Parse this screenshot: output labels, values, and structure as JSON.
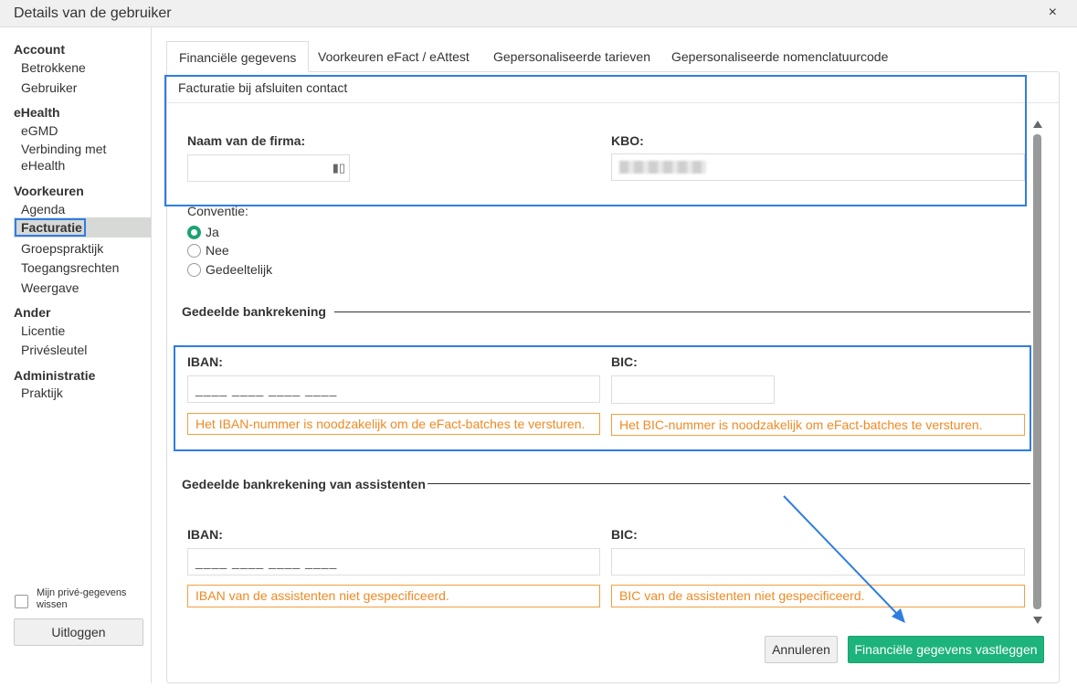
{
  "window": {
    "title": "Details van de gebruiker",
    "close_icon": "×"
  },
  "sidebar": {
    "groups": [
      {
        "heading": "Account",
        "items": [
          "Betrokkene",
          "Gebruiker"
        ]
      },
      {
        "heading": "eHealth",
        "items": [
          "eGMD",
          "Verbinding met",
          "eHealth"
        ]
      },
      {
        "heading": "Voorkeuren",
        "items": [
          "Agenda",
          "Facturatie",
          "Groepspraktijk",
          "Toegangsrechten",
          "Weergave"
        ]
      },
      {
        "heading": "Ander",
        "items": [
          "Licentie",
          "Privésleutel"
        ]
      },
      {
        "heading": "Administratie",
        "items": [
          "Praktijk"
        ]
      }
    ],
    "active_item": "Facturatie",
    "private_data_label": "Mijn privé-gegevens wissen",
    "logout_label": "Uitloggen"
  },
  "tabs": [
    {
      "label": "Financiële gegevens",
      "active": true
    },
    {
      "label": "Voorkeuren eFact / eAttest",
      "active": false
    },
    {
      "label": "Gepersonaliseerde tarieven",
      "active": false
    },
    {
      "label": "Gepersonaliseerde nomenclatuurcode",
      "active": false
    }
  ],
  "form": {
    "section_title": "Facturatie bij afsluiten contact",
    "company_name_label": "Naam van de firma:",
    "company_name_value": "",
    "kbo_label": "KBO:",
    "convention_label": "Conventie:",
    "convention_options": [
      {
        "label": "Ja",
        "selected": true
      },
      {
        "label": "Nee",
        "selected": false
      },
      {
        "label": "Gedeeltelijk",
        "selected": false
      }
    ],
    "shared_account": {
      "title": "Gedeelde bankrekening",
      "iban_label": "IBAN:",
      "iban_mask": "____ ____ ____ ____",
      "bic_label": "BIC:",
      "bic_value": "",
      "iban_warning": "Het IBAN-nummer is noodzakelijk om de eFact-batches te versturen.",
      "bic_warning": "Het BIC-nummer is noodzakelijk om eFact-batches te versturen."
    },
    "assistants_account": {
      "title": "Gedeelde bankrekening van assistenten",
      "iban_label": "IBAN:",
      "iban_mask": "____ ____ ____ ____",
      "bic_label": "BIC:",
      "bic_value": "",
      "iban_warning": "IBAN van de assistenten niet gespecificeerd.",
      "bic_warning": "BIC van de assistenten niet gespecificeerd."
    }
  },
  "actions": {
    "cancel_label": "Annuleren",
    "save_label": "Financiële gegevens vastleggen"
  },
  "colors": {
    "accent_green": "#1db37c",
    "highlight_blue": "#2f7de1",
    "warning_orange": "#f08a24"
  },
  "icons": {
    "close": "close-icon",
    "field_menu": "field-menu-icon",
    "scroll_up": "scroll-up-icon",
    "scroll_down": "scroll-down-icon"
  }
}
